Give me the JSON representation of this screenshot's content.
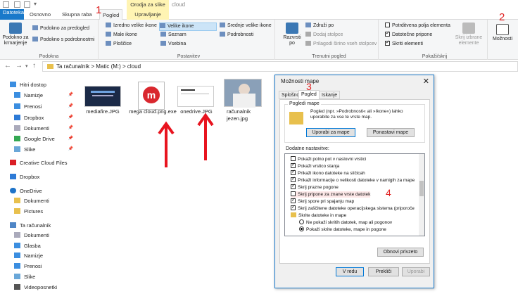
{
  "window": {
    "title": "cloud",
    "tools_context": "Orodja za slike"
  },
  "tabs": [
    "Datoteka",
    "Osnovno",
    "Skupna raba",
    "Pogled",
    "Upravljanje"
  ],
  "ribbon": {
    "podokna": {
      "label": "Podokna",
      "nav_pane": "Podokno za krmarjenje",
      "preview": "Podokno za predogled",
      "details": "Podokno s podrobnostmi"
    },
    "postavitev": {
      "label": "Postavitev",
      "items": [
        "Izredno velike ikone",
        "Velike ikone",
        "Srednje velike ikone",
        "Male ikone",
        "Seznam",
        "Podrobnosti",
        "Ploščice",
        "Vsebina"
      ]
    },
    "trenutni": {
      "label": "Trenutni pogled",
      "sort": "Razvrsti po",
      "group": "Združi po",
      "add_cols": "Dodaj stolpce",
      "fit_cols": "Prilagodi širino vseh stolpcev"
    },
    "pokazi": {
      "label": "Pokaži/skrij",
      "item_checkboxes": "Potrditvena polja elementa",
      "extensions": "Datotečne pripone",
      "hidden": "Skriti elementi",
      "hide_selected": "Skrij izbrane elemente"
    },
    "options": "Možnosti"
  },
  "address": {
    "path": "Ta računalnik  >  Matic (M:)  >  cloud"
  },
  "nav": {
    "quick": "Hitri dostop",
    "items": [
      "Namizje",
      "Prenosi",
      "Dropbox",
      "Dokumenti",
      "Google Drive",
      "Slike"
    ],
    "creative": "Creative Cloud Files",
    "dropbox": "Dropbox",
    "onedrive": "OneDrive",
    "od_items": [
      "Dokumenti",
      "Pictures"
    ],
    "pc": "Ta računalnik",
    "pc_items": [
      "Dokumenti",
      "Glasba",
      "Namizje",
      "Prenosi",
      "Slike",
      "Videoposnetki"
    ]
  },
  "files": [
    "mediafire.JPG",
    "mega cloud.png.exe",
    "onedrive.JPG",
    "računalnik jezen.jpg"
  ],
  "annotations": [
    "1",
    "2",
    "3",
    "4"
  ],
  "dialog": {
    "title": "Možnosti mape",
    "tabs": [
      "Splošno",
      "Pogled",
      "Iskanje"
    ],
    "folder_views": "Pogledi mape",
    "folder_text": "Pogled (npr. »Podrobnosti« ali »Ikone«) lahko uporabite za vse te vrste map.",
    "apply": "Uporabi za mape",
    "reset": "Ponastavi mape",
    "advanced": "Dodatne nastavitve:",
    "adv_items": [
      "Pokaži polno pot v naslovni vrstici",
      "Pokaži vrstico stanja",
      "Prikaži ikono datoteke na sličicah",
      "Prikaži informacije o velikosti datoteke v namigih za mape",
      "Skrij prazne pogone",
      "Skrij pripone za znane vrste datotek",
      "Skrij spore pri spajanju map",
      "Skrij zaščitene datoteke operacijskega sistema (priporoče",
      "Skrite datoteke in mape",
      "Ne pokaži skritih datotek, map ali pogonov",
      "Pokaži skrite datoteke, mape in pogone"
    ],
    "restore": "Obnovi privzeto",
    "ok": "V redu",
    "cancel": "Prekliči",
    "apply_btn": "Uporabi"
  }
}
